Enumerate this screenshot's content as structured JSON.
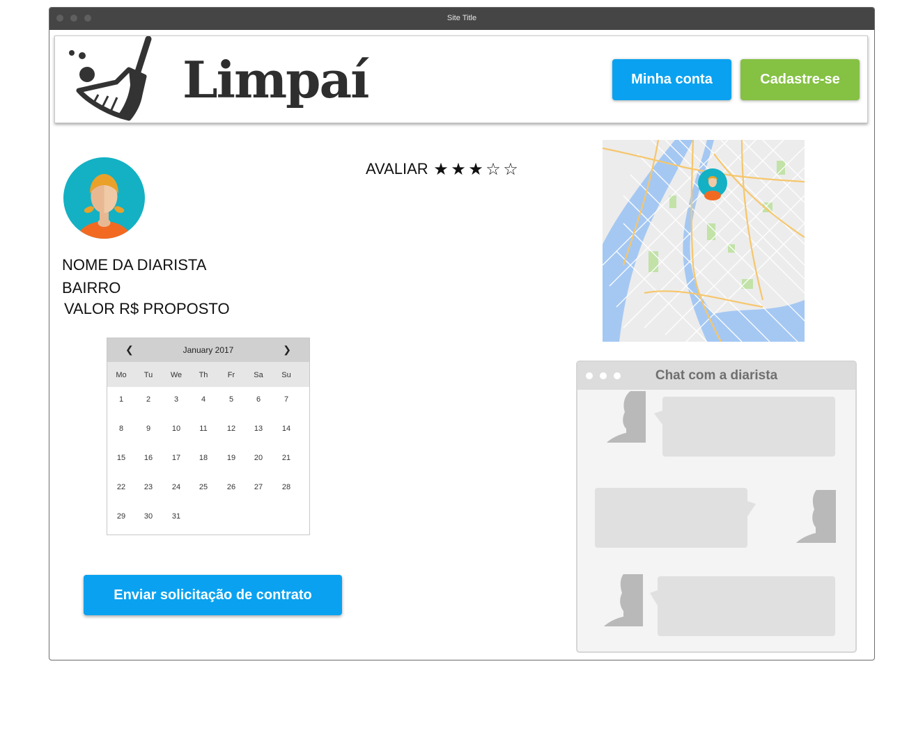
{
  "window": {
    "title": "Site Title"
  },
  "header": {
    "brand": "Limpaí",
    "account_button": "Minha conta",
    "signup_button": "Cadastre-se"
  },
  "profile": {
    "name": "NOME DA DIARISTA",
    "neighborhood": "BAIRRO",
    "price": "VALOR R$ PROPOSTO"
  },
  "rating": {
    "label": "AVALIAR",
    "value": 3,
    "max": 5,
    "filled_star": "★",
    "empty_star": "☆"
  },
  "calendar": {
    "prev": "❮",
    "next": "❯",
    "month": "January 2017",
    "weekdays": [
      "Mo",
      "Tu",
      "We",
      "Th",
      "Fr",
      "Sa",
      "Su"
    ],
    "days": [
      "1",
      "2",
      "3",
      "4",
      "5",
      "6",
      "7",
      "8",
      "9",
      "10",
      "11",
      "12",
      "13",
      "14",
      "15",
      "16",
      "17",
      "18",
      "19",
      "20",
      "21",
      "22",
      "23",
      "24",
      "25",
      "26",
      "27",
      "28",
      "29",
      "30",
      "31"
    ]
  },
  "actions": {
    "send_request": "Enviar solicitação de contrato"
  },
  "chat": {
    "title": "Chat com a diarista"
  },
  "colors": {
    "primary": "#0aa2f0",
    "success": "#85c143",
    "titlebar": "#454545",
    "avatar_bg": "#13b1c3",
    "avatar_shirt": "#f26a22",
    "avatar_hair": "#e9a12a"
  }
}
